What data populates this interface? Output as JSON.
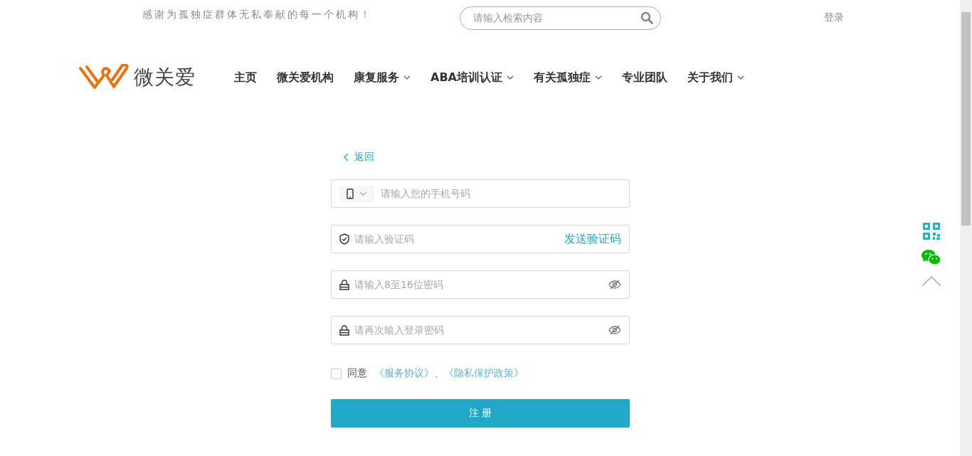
{
  "header": {
    "tagline": "感谢为孤独症群体无私奉献的每一个机构！",
    "search": {
      "placeholder": "请输入检索内容"
    },
    "login": "登录"
  },
  "logo": {
    "text": "微关爱"
  },
  "nav": [
    {
      "label": "主页",
      "has_dropdown": false
    },
    {
      "label": "微关爱机构",
      "has_dropdown": false
    },
    {
      "label": "康复服务",
      "has_dropdown": true
    },
    {
      "label": "ABA培训认证",
      "has_dropdown": true
    },
    {
      "label": "有关孤独症",
      "has_dropdown": true
    },
    {
      "label": "专业团队",
      "has_dropdown": false
    },
    {
      "label": "关于我们",
      "has_dropdown": true
    }
  ],
  "form": {
    "back": "返回",
    "fields": [
      {
        "kind": "phone",
        "placeholder": "请输入您的手机号码"
      },
      {
        "kind": "code",
        "placeholder": "请输入验证码",
        "action": "发送验证码"
      },
      {
        "kind": "password",
        "placeholder": "请输入8至16位密码"
      },
      {
        "kind": "password",
        "placeholder": "请再次输入登录密码"
      }
    ],
    "agree": {
      "checked": false,
      "label": "同意",
      "links": [
        "《服务协议》",
        "《隐私保护政策》"
      ],
      "separator": "、"
    },
    "submit": "注 册"
  }
}
